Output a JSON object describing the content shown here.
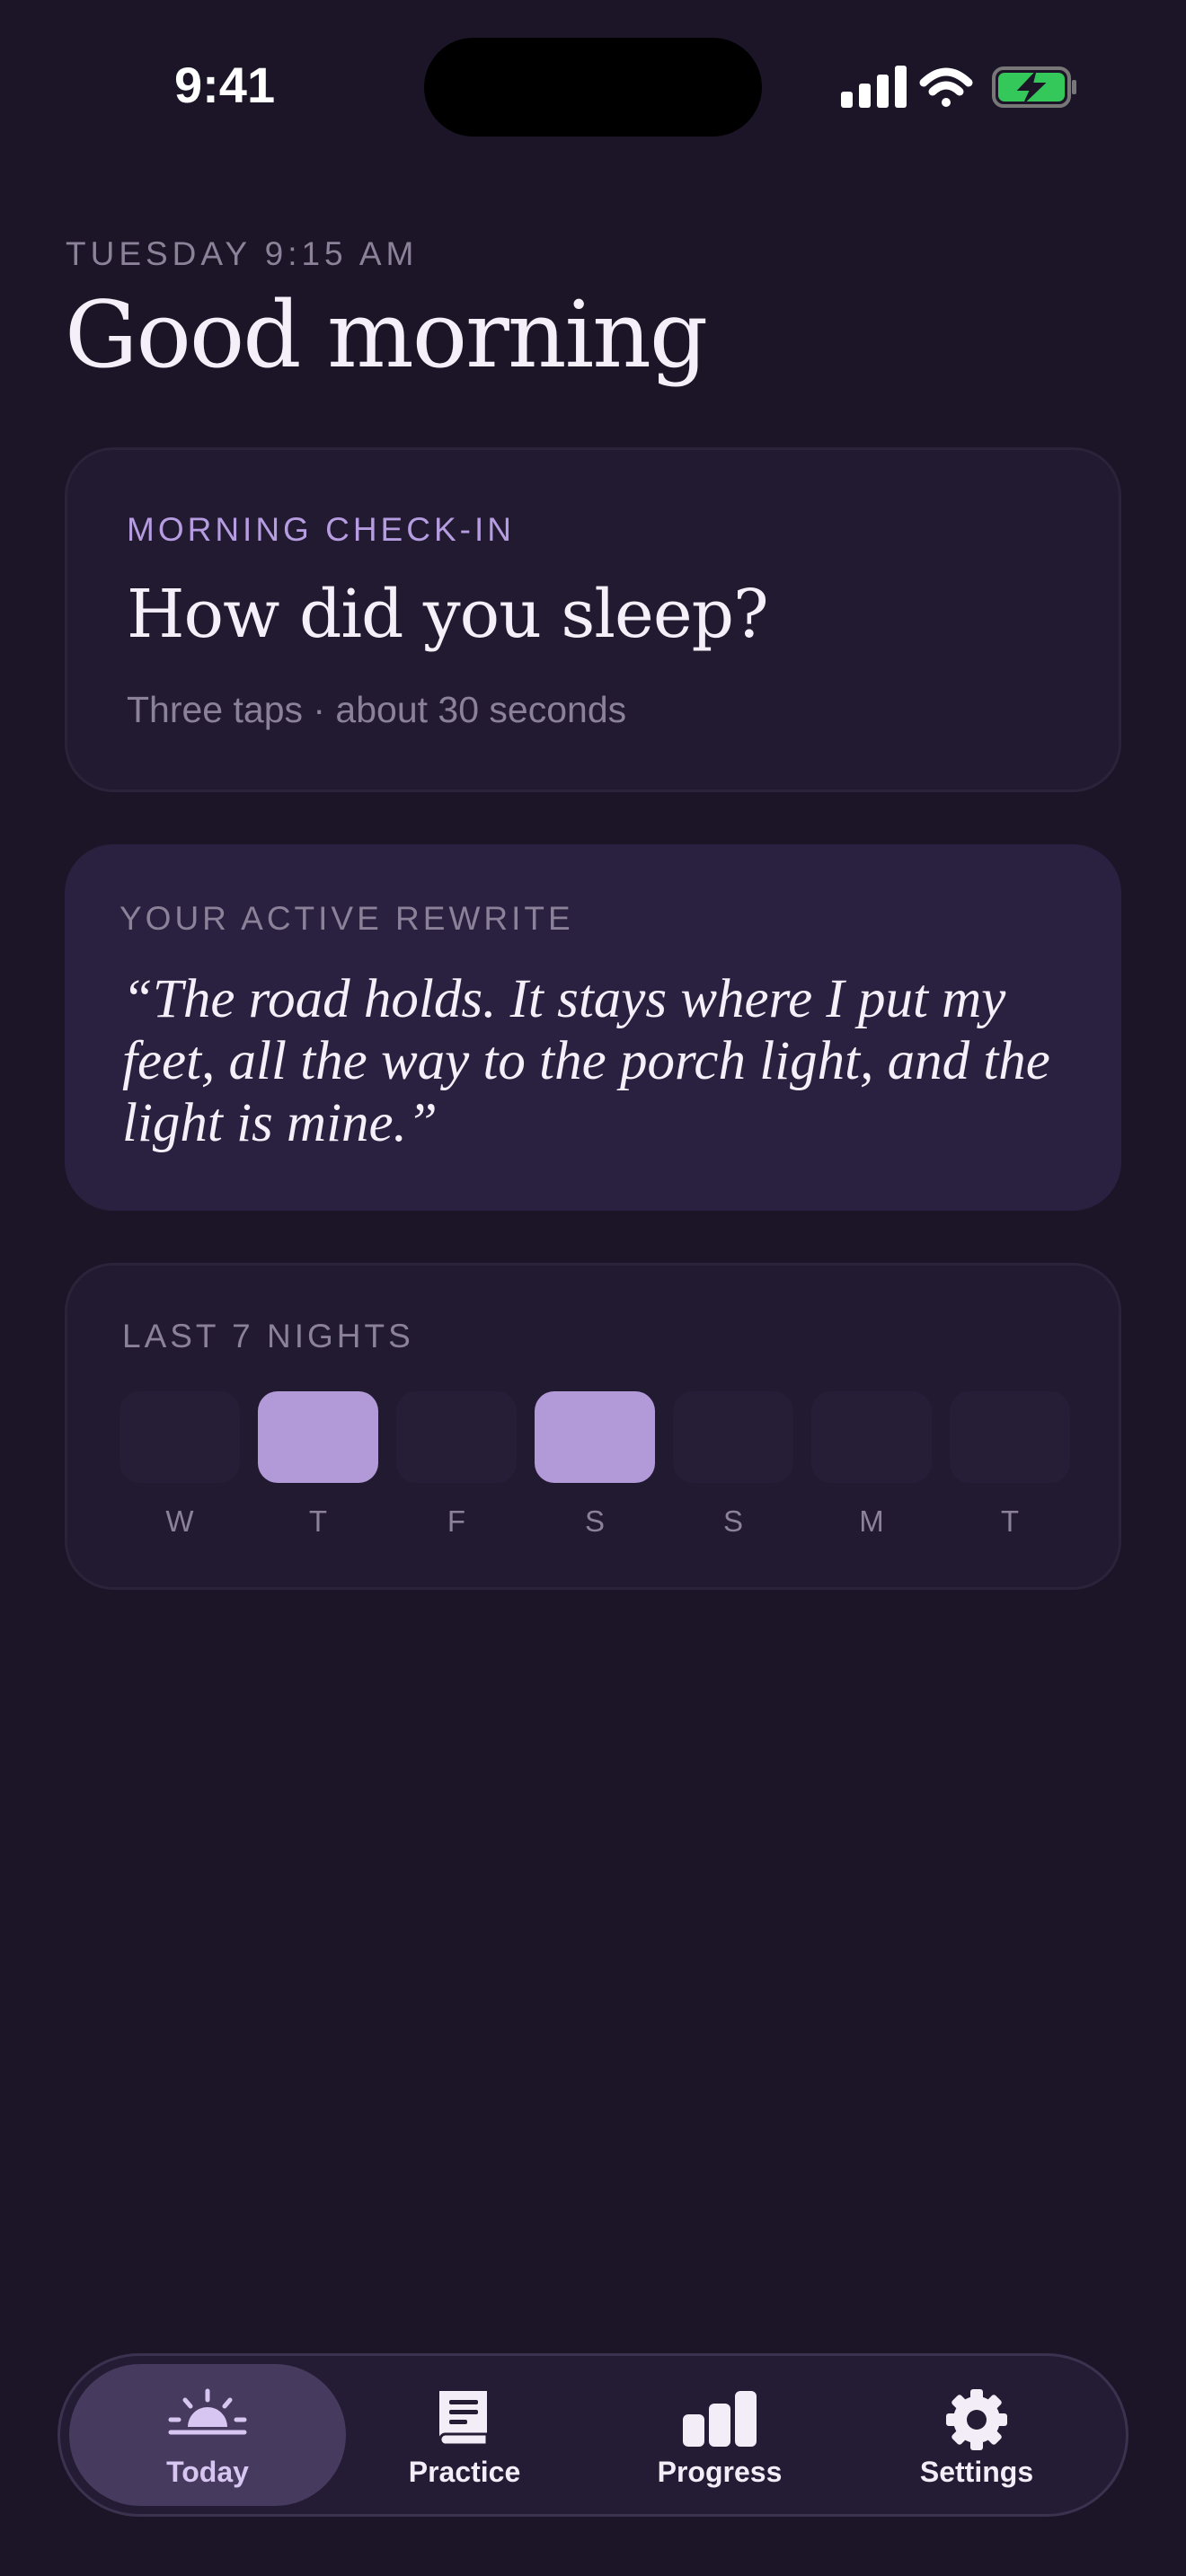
{
  "status_bar": {
    "time": "9:41"
  },
  "header": {
    "date": "TUESDAY 9:15 AM",
    "greeting": "Good morning"
  },
  "checkin_card": {
    "kicker": "MORNING CHECK-IN",
    "title": "How did you sleep?",
    "subtitle": "Three taps · about 30 seconds"
  },
  "rewrite_card": {
    "kicker": "YOUR ACTIVE REWRITE",
    "quote": "“The road holds. It stays where I put my feet, all the way to the porch light, and the light is mine.”"
  },
  "nights_card": {
    "kicker": "LAST 7 NIGHTS",
    "nights": [
      {
        "day": "W",
        "logged": false
      },
      {
        "day": "T",
        "logged": true
      },
      {
        "day": "F",
        "logged": false
      },
      {
        "day": "S",
        "logged": true
      },
      {
        "day": "S",
        "logged": false
      },
      {
        "day": "M",
        "logged": false
      },
      {
        "day": "T",
        "logged": false
      }
    ]
  },
  "tabbar": {
    "tabs": [
      {
        "label": "Today",
        "icon": "sunrise-icon",
        "active": true
      },
      {
        "label": "Practice",
        "icon": "book-icon",
        "active": false
      },
      {
        "label": "Progress",
        "icon": "bar-chart-icon",
        "active": false
      },
      {
        "label": "Settings",
        "icon": "gear-icon",
        "active": false
      }
    ]
  },
  "colors": {
    "background": "#1b1527",
    "accent": "#b299d8",
    "card": "#211a30",
    "rewrite_card": "#2a2140",
    "battery_green": "#34c759"
  }
}
